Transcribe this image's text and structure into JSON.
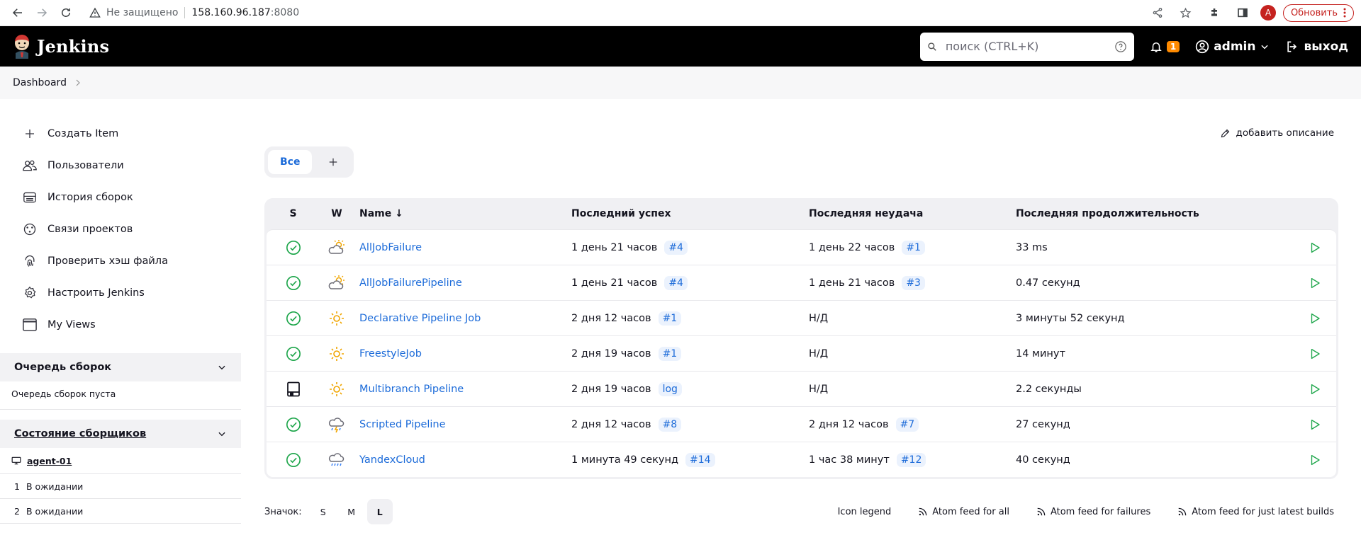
{
  "browser": {
    "security_label": "Не защищено",
    "host": "158.160.96.187",
    "port": ":8080",
    "profile_initial": "A",
    "update_label": "Обновить"
  },
  "header": {
    "title": "Jenkins",
    "search_placeholder": "поиск (CTRL+K)",
    "notifications_count": "1",
    "user": "admin",
    "logout": "выход"
  },
  "breadcrumb": {
    "dashboard": "Dashboard"
  },
  "sidebar": {
    "tasks": [
      {
        "label": "Создать Item",
        "icon": "plus-icon"
      },
      {
        "label": "Пользователи",
        "icon": "users-icon"
      },
      {
        "label": "История сборок",
        "icon": "build-history-icon"
      },
      {
        "label": "Связи проектов",
        "icon": "relationship-icon"
      },
      {
        "label": "Проверить хэш файла",
        "icon": "fingerprint-icon"
      },
      {
        "label": "Настроить Jenkins",
        "icon": "gear-icon"
      },
      {
        "label": "My Views",
        "icon": "window-icon"
      }
    ],
    "queue": {
      "title": "Очередь сборок",
      "empty_text": "Очередь сборок пуста"
    },
    "executors": {
      "title": "Состояние сборщиков",
      "agent": "agent-01",
      "slots": [
        {
          "num": "1",
          "status": "В ожидании"
        },
        {
          "num": "2",
          "status": "В ожидании"
        }
      ]
    }
  },
  "content": {
    "add_description": "добавить описание",
    "tabs": {
      "all": "Все",
      "add": "+"
    },
    "table": {
      "headers": {
        "s": "S",
        "w": "W",
        "name": "Name",
        "name_sort": "↓",
        "last_success": "Последний успех",
        "last_failure": "Последняя неудача",
        "last_duration": "Последняя продолжительность"
      },
      "rows": [
        {
          "status": "success",
          "weather": "partly-cloudy",
          "name": "AllJobFailure",
          "success_time": "1 день 21 часов",
          "success_build": "#4",
          "failure_time": "1 день 22 часов",
          "failure_build": "#1",
          "duration": "33 ms"
        },
        {
          "status": "success",
          "weather": "partly-cloudy",
          "name": "AllJobFailurePipeline",
          "success_time": "1 день 21 часов",
          "success_build": "#4",
          "failure_time": "1 день 21 часов",
          "failure_build": "#3",
          "duration": "0.47 секунд"
        },
        {
          "status": "success",
          "weather": "sunny",
          "name": "Declarative Pipeline Job",
          "success_time": "2 дня 12 часов",
          "success_build": "#1",
          "failure_time": "Н/Д",
          "failure_build": "",
          "duration": "3 минуты 52 секунд"
        },
        {
          "status": "success",
          "weather": "sunny",
          "name": "FreestyleJob",
          "success_time": "2 дня 19 часов",
          "success_build": "#1",
          "failure_time": "Н/Д",
          "failure_build": "",
          "duration": "14 минут"
        },
        {
          "status": "folder",
          "weather": "sunny",
          "name": "Multibranch Pipeline",
          "success_time": "2 дня 19 часов",
          "success_build": "log",
          "failure_time": "Н/Д",
          "failure_build": "",
          "duration": "2.2 секунды"
        },
        {
          "status": "success",
          "weather": "thunder",
          "name": "Scripted Pipeline",
          "success_time": "2 дня 12 часов",
          "success_build": "#8",
          "failure_time": "2 дня 12 часов",
          "failure_build": "#7",
          "duration": "27 секунд"
        },
        {
          "status": "success",
          "weather": "rain",
          "name": "YandexCloud",
          "success_time": "1 минута 49 секунд",
          "success_build": "#14",
          "failure_time": "1 час 38 минут",
          "failure_build": "#12",
          "duration": "40 секунд"
        }
      ]
    },
    "footer": {
      "icon_label": "Значок:",
      "sizes": [
        "S",
        "M",
        "L"
      ],
      "active_size": "L",
      "icon_legend": "Icon legend",
      "feed_all": "Atom feed for all",
      "feed_failures": "Atom feed for failures",
      "feed_latest": "Atom feed for just latest builds"
    }
  },
  "colors": {
    "header_bg": "#000000",
    "link": "#1c6bd9",
    "success": "#1ea64b",
    "badge": "#fe8a00",
    "build_chip_bg": "#ebf2fd"
  }
}
